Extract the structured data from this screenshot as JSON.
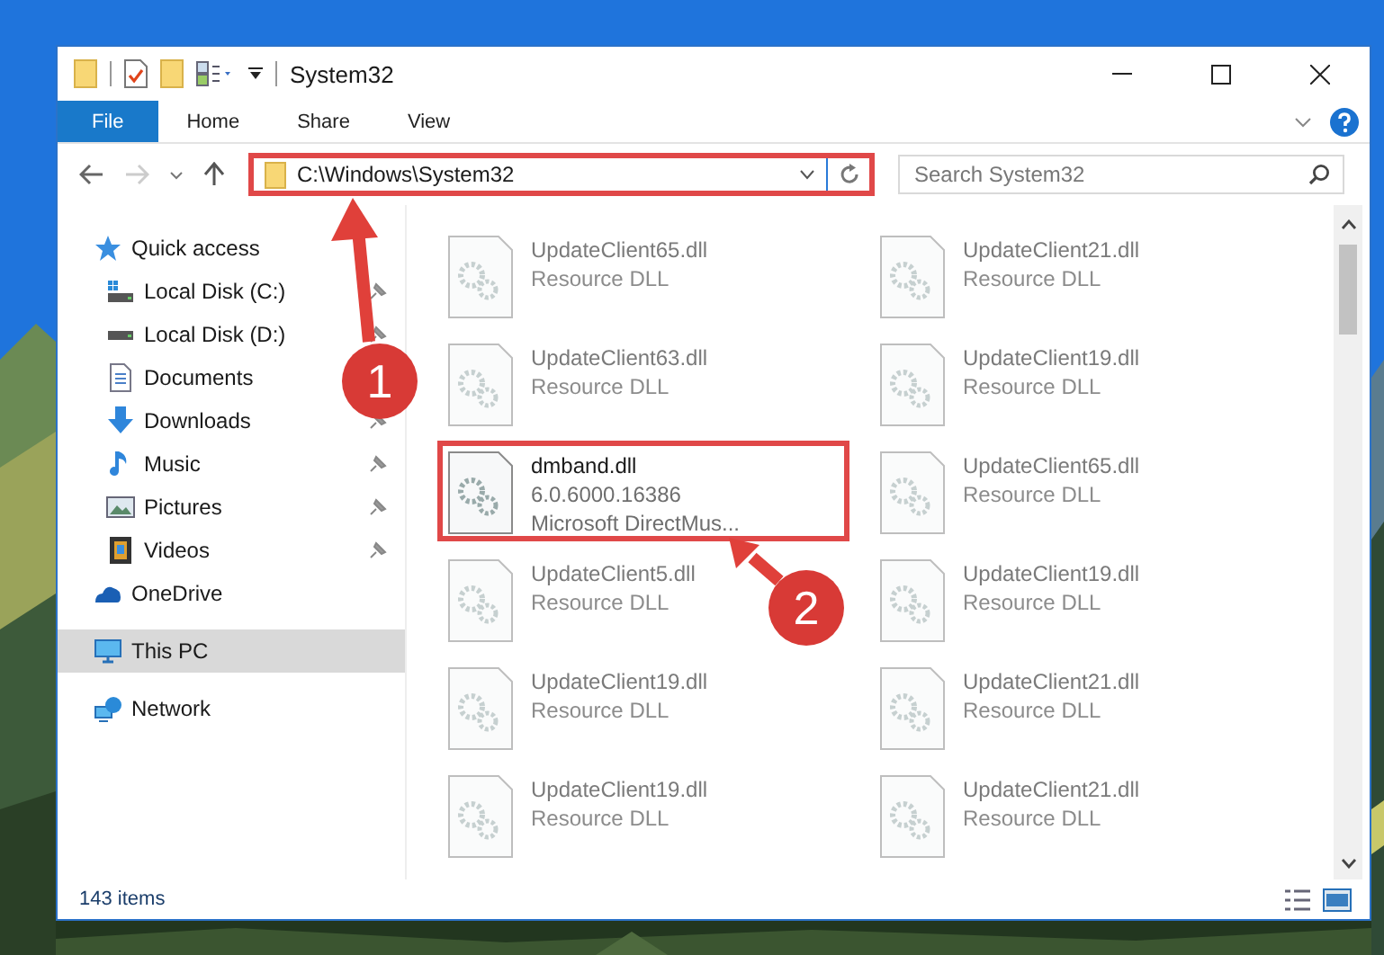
{
  "window": {
    "title": "System32"
  },
  "ribbon_tabs": [
    {
      "label": "File",
      "kind": "file",
      "selected": false
    },
    {
      "label": "Home",
      "kind": "tab",
      "selected": false
    },
    {
      "label": "Share",
      "kind": "tab",
      "selected": false
    },
    {
      "label": "View",
      "kind": "tab",
      "selected": false
    }
  ],
  "address_bar": {
    "value": "C:\\Windows\\System32",
    "highlighted": true
  },
  "search": {
    "placeholder": "Search System32"
  },
  "navigation": [
    {
      "label": "Quick access",
      "kind": "star",
      "selected": false,
      "pinned": false,
      "children": [
        {
          "label": "Local Disk (C:)",
          "kind": "system-drive",
          "selected": false,
          "pinned": true
        },
        {
          "label": "Local Disk (D:)",
          "kind": "drive",
          "selected": false,
          "pinned": true
        },
        {
          "label": "Documents",
          "kind": "documents",
          "selected": false,
          "pinned": false
        },
        {
          "label": "Downloads",
          "kind": "downloads",
          "selected": false,
          "pinned": true
        },
        {
          "label": "Music",
          "kind": "music",
          "selected": false,
          "pinned": true
        },
        {
          "label": "Pictures",
          "kind": "pictures",
          "selected": false,
          "pinned": true
        },
        {
          "label": "Videos",
          "kind": "videos",
          "selected": false,
          "pinned": true
        }
      ]
    },
    {
      "label": "OneDrive",
      "kind": "cloud",
      "selected": false,
      "pinned": false
    },
    {
      "label": "This PC",
      "kind": "computer",
      "selected": true,
      "pinned": false
    },
    {
      "label": "Network",
      "kind": "network",
      "selected": false,
      "pinned": false
    }
  ],
  "files": [
    {
      "name": "UpdateClient65.dll",
      "details": [
        "Resource DLL"
      ],
      "blurred": true,
      "highlighted": false
    },
    {
      "name": "UpdateClient21.dll",
      "details": [
        "Resource DLL"
      ],
      "blurred": true,
      "highlighted": false
    },
    {
      "name": "UpdateClient63.dll",
      "details": [
        "Resource DLL"
      ],
      "blurred": true,
      "highlighted": false
    },
    {
      "name": "UpdateClient19.dll",
      "details": [
        "Resource DLL"
      ],
      "blurred": true,
      "highlighted": false
    },
    {
      "name": "dmband.dll",
      "details": [
        "6.0.6000.16386",
        "Microsoft DirectMus..."
      ],
      "blurred": false,
      "highlighted": true
    },
    {
      "name": "UpdateClient65.dll",
      "details": [
        "Resource DLL"
      ],
      "blurred": true,
      "highlighted": false
    },
    {
      "name": "UpdateClient5.dll",
      "details": [
        "Resource DLL"
      ],
      "blurred": true,
      "highlighted": false
    },
    {
      "name": "UpdateClient19.dll",
      "details": [
        "Resource DLL"
      ],
      "blurred": true,
      "highlighted": false
    },
    {
      "name": "UpdateClient19.dll",
      "details": [
        "Resource DLL"
      ],
      "blurred": true,
      "highlighted": false
    },
    {
      "name": "UpdateClient21.dll",
      "details": [
        "Resource DLL"
      ],
      "blurred": true,
      "highlighted": false
    },
    {
      "name": "UpdateClient19.dll",
      "details": [
        "Resource DLL"
      ],
      "blurred": true,
      "highlighted": false
    },
    {
      "name": "UpdateClient21.dll",
      "details": [
        "Resource DLL"
      ],
      "blurred": true,
      "highlighted": false
    }
  ],
  "status_bar": {
    "item_count": "143 items"
  },
  "annotations": [
    {
      "number": "1"
    },
    {
      "number": "2"
    }
  ]
}
